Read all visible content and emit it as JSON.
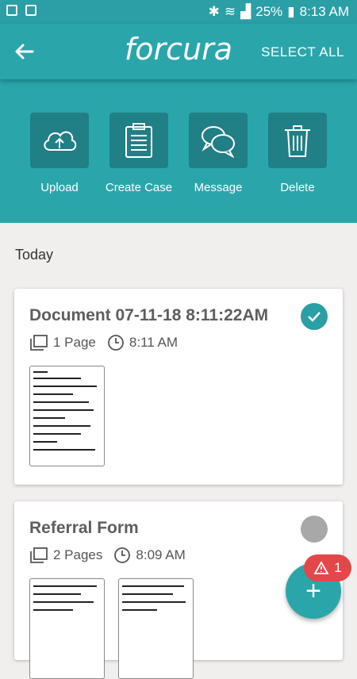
{
  "status_bar": {
    "battery": "25%",
    "time": "8:13 AM"
  },
  "app_bar": {
    "logo": "forcura",
    "select_all": "SELECT ALL"
  },
  "actions": [
    {
      "label": "Upload",
      "icon": "cloud-upload-icon"
    },
    {
      "label": "Create Case",
      "icon": "clipboard-icon"
    },
    {
      "label": "Message",
      "icon": "chat-bubbles-icon"
    },
    {
      "label": "Delete",
      "icon": "trash-icon"
    }
  ],
  "section_header": "Today",
  "documents": [
    {
      "title": "Document 07-11-18 8:11:22AM",
      "pages": "1 Page",
      "time": "8:11 AM",
      "selected": true,
      "thumbnails": 1
    },
    {
      "title": "Referral Form",
      "pages": "2 Pages",
      "time": "8:09 AM",
      "selected": false,
      "thumbnails": 2
    }
  ],
  "fab": {
    "icon": "plus-icon",
    "label": "+"
  },
  "alert_badge": {
    "icon": "warning-icon",
    "count": "1"
  },
  "colors": {
    "primary": "#2aa6ab",
    "tile": "#217f86",
    "alert": "#e2474a",
    "background": "#f1efee"
  }
}
